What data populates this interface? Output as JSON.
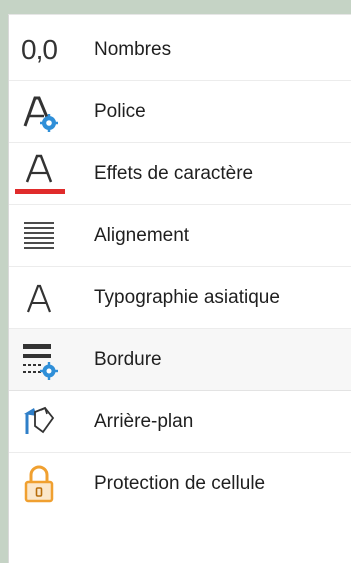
{
  "menu": {
    "items": [
      {
        "label": "Nombres",
        "icon": "number-format-icon",
        "icon_text": "0,0"
      },
      {
        "label": "Police",
        "icon": "font-settings-icon"
      },
      {
        "label": "Effets de caractère",
        "icon": "font-color-icon"
      },
      {
        "label": "Alignement",
        "icon": "alignment-icon"
      },
      {
        "label": "Typographie asiatique",
        "icon": "asian-typography-icon"
      },
      {
        "label": "Bordure",
        "icon": "borders-settings-icon"
      },
      {
        "label": "Arrière-plan",
        "icon": "paint-bucket-icon"
      },
      {
        "label": "Protection de cellule",
        "icon": "padlock-icon"
      }
    ],
    "selected_index": 5
  },
  "colors": {
    "underline_red": "#e02b2b",
    "gear_blue": "#2f8fd8",
    "lock_orange": "#f0a030"
  }
}
